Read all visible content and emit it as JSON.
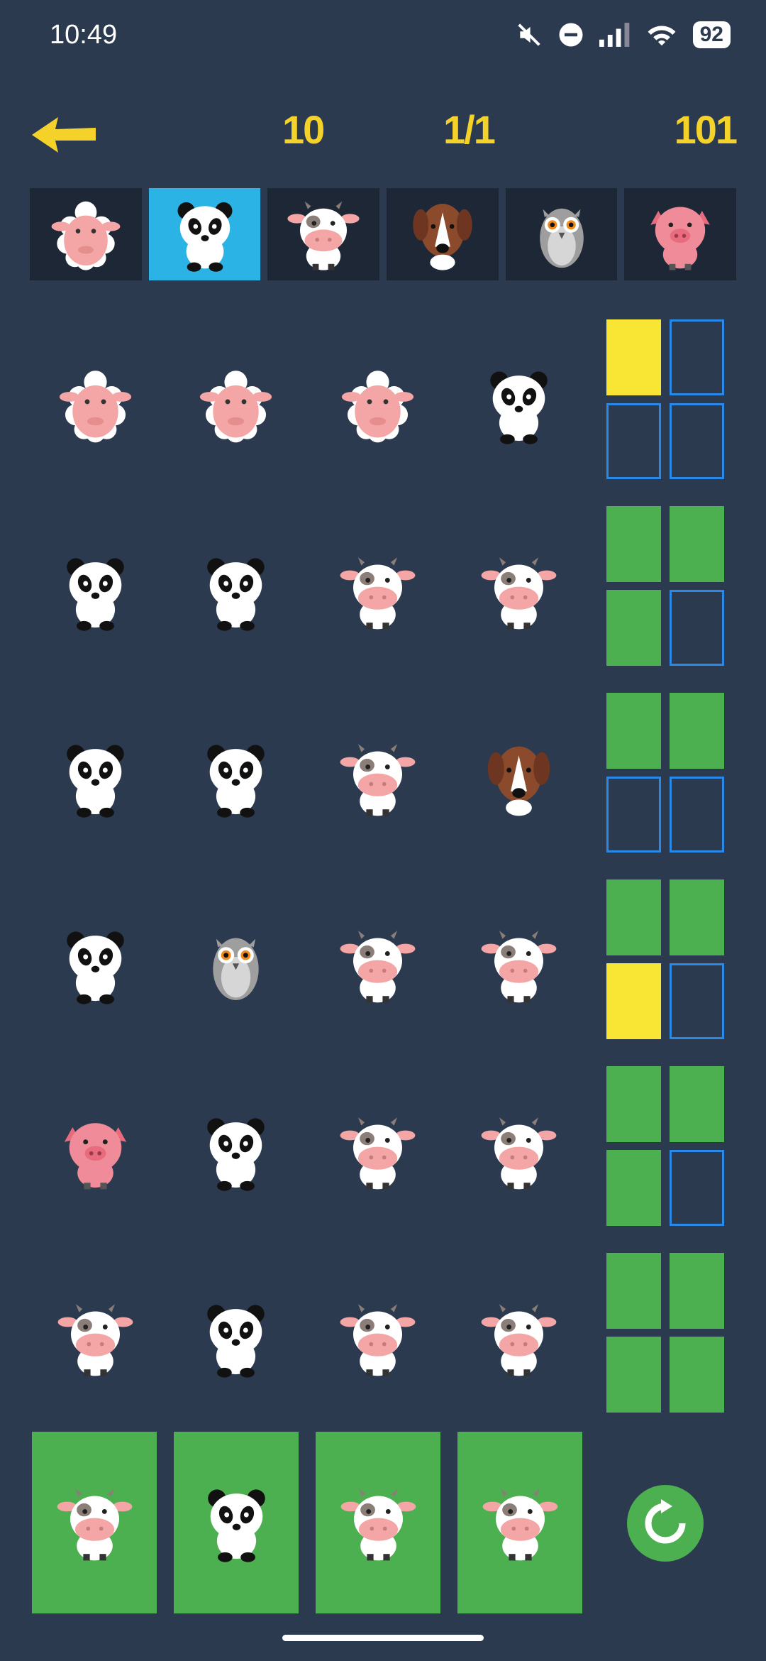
{
  "status_bar": {
    "time": "10:49",
    "battery": "92"
  },
  "header": {
    "moves": "10",
    "round": "1/1",
    "score": "101"
  },
  "animals": [
    {
      "name": "sheep"
    },
    {
      "name": "panda"
    },
    {
      "name": "cow"
    },
    {
      "name": "dog"
    },
    {
      "name": "owl"
    },
    {
      "name": "pig"
    }
  ],
  "selected_animal": "panda",
  "guesses": [
    [
      "sheep",
      "sheep",
      "sheep",
      "panda"
    ],
    [
      "panda",
      "panda",
      "cow",
      "cow"
    ],
    [
      "panda",
      "panda",
      "cow",
      "dog"
    ],
    [
      "panda",
      "owl",
      "cow",
      "cow"
    ],
    [
      "pig",
      "panda",
      "cow",
      "cow"
    ],
    [
      "cow",
      "panda",
      "cow",
      "cow"
    ]
  ],
  "feedback": [
    [
      "yellow",
      "empty",
      "empty",
      "empty"
    ],
    [
      "green",
      "green",
      "green",
      "empty"
    ],
    [
      "green",
      "green",
      "empty",
      "empty"
    ],
    [
      "green",
      "green",
      "yellow",
      "empty"
    ],
    [
      "green",
      "green",
      "green",
      "empty"
    ],
    [
      "green",
      "green",
      "green",
      "green"
    ]
  ],
  "answer": [
    "cow",
    "panda",
    "cow",
    "cow"
  ],
  "colors": {
    "background": "#2c3a4f",
    "accent": "#f5d22a",
    "green": "#4caf50",
    "yellow": "#f9e534",
    "selected": "#2bb3e6",
    "outline": "#2a88e6"
  }
}
